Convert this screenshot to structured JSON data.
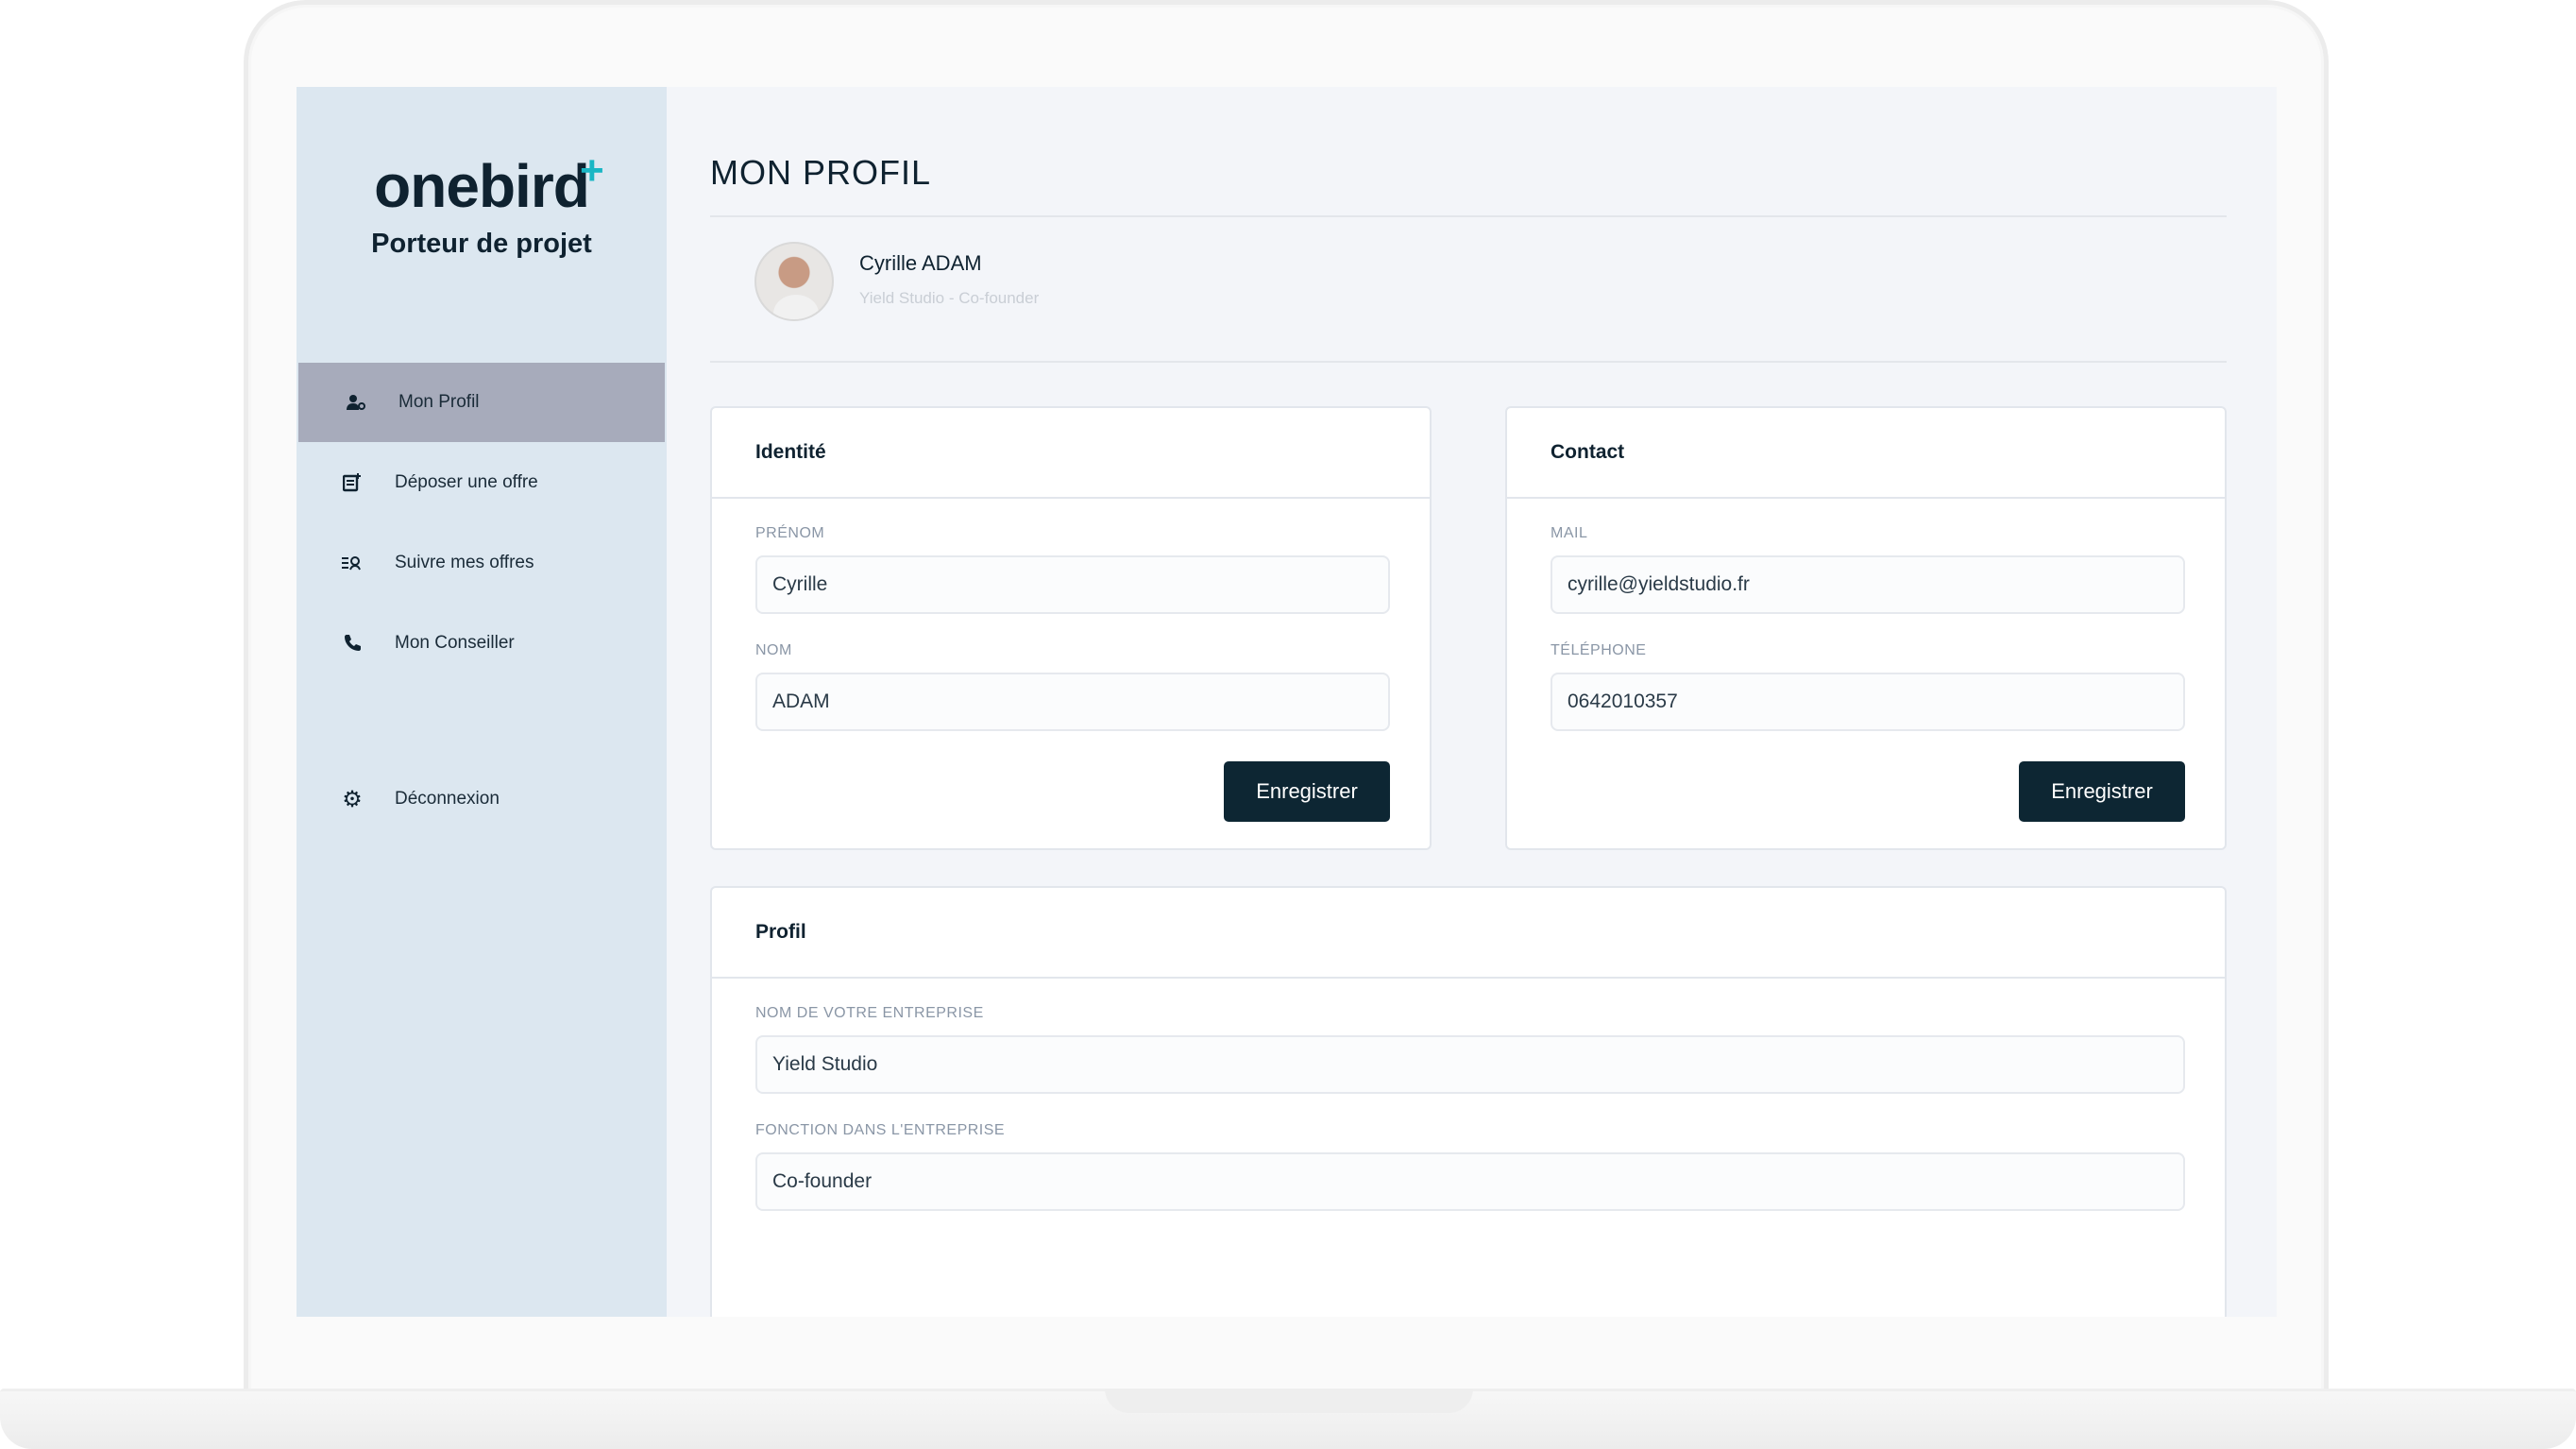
{
  "brand": {
    "name": "onebird",
    "plus": "+",
    "subtitle": "Porteur de projet"
  },
  "sidebar": {
    "items": [
      {
        "label": "Mon Profil",
        "icon": "user-profile-icon",
        "active": true
      },
      {
        "label": "Déposer une offre",
        "icon": "add-document-icon"
      },
      {
        "label": "Suivre mes offres",
        "icon": "list-search-icon"
      },
      {
        "label": "Mon Conseiller",
        "icon": "phone-icon"
      }
    ],
    "logout": {
      "label": "Déconnexion",
      "icon": "gear-icon"
    }
  },
  "page": {
    "title": "MON PROFIL"
  },
  "user": {
    "name": "Cyrille ADAM",
    "subtitle": "Yield Studio - Co-founder"
  },
  "identity": {
    "title": "Identité",
    "firstname_label": "PRÉNOM",
    "firstname_value": "Cyrille",
    "lastname_label": "NOM",
    "lastname_value": "ADAM",
    "save_label": "Enregistrer"
  },
  "contact": {
    "title": "Contact",
    "mail_label": "MAIL",
    "mail_value": "cyrille@yieldstudio.fr",
    "phone_label": "TÉLÉPHONE",
    "phone_value": "0642010357",
    "save_label": "Enregistrer"
  },
  "profile": {
    "title": "Profil",
    "company_label": "NOM DE VOTRE ENTREPRISE",
    "company_value": "Yield Studio",
    "role_label": "FONCTION DANS L'ENTREPRISE",
    "role_value": "Co-founder"
  },
  "colors": {
    "accent": "#19b6c4",
    "dark": "#0d2633",
    "sidebar": "#dce7f0",
    "active": "#a7abbb"
  }
}
